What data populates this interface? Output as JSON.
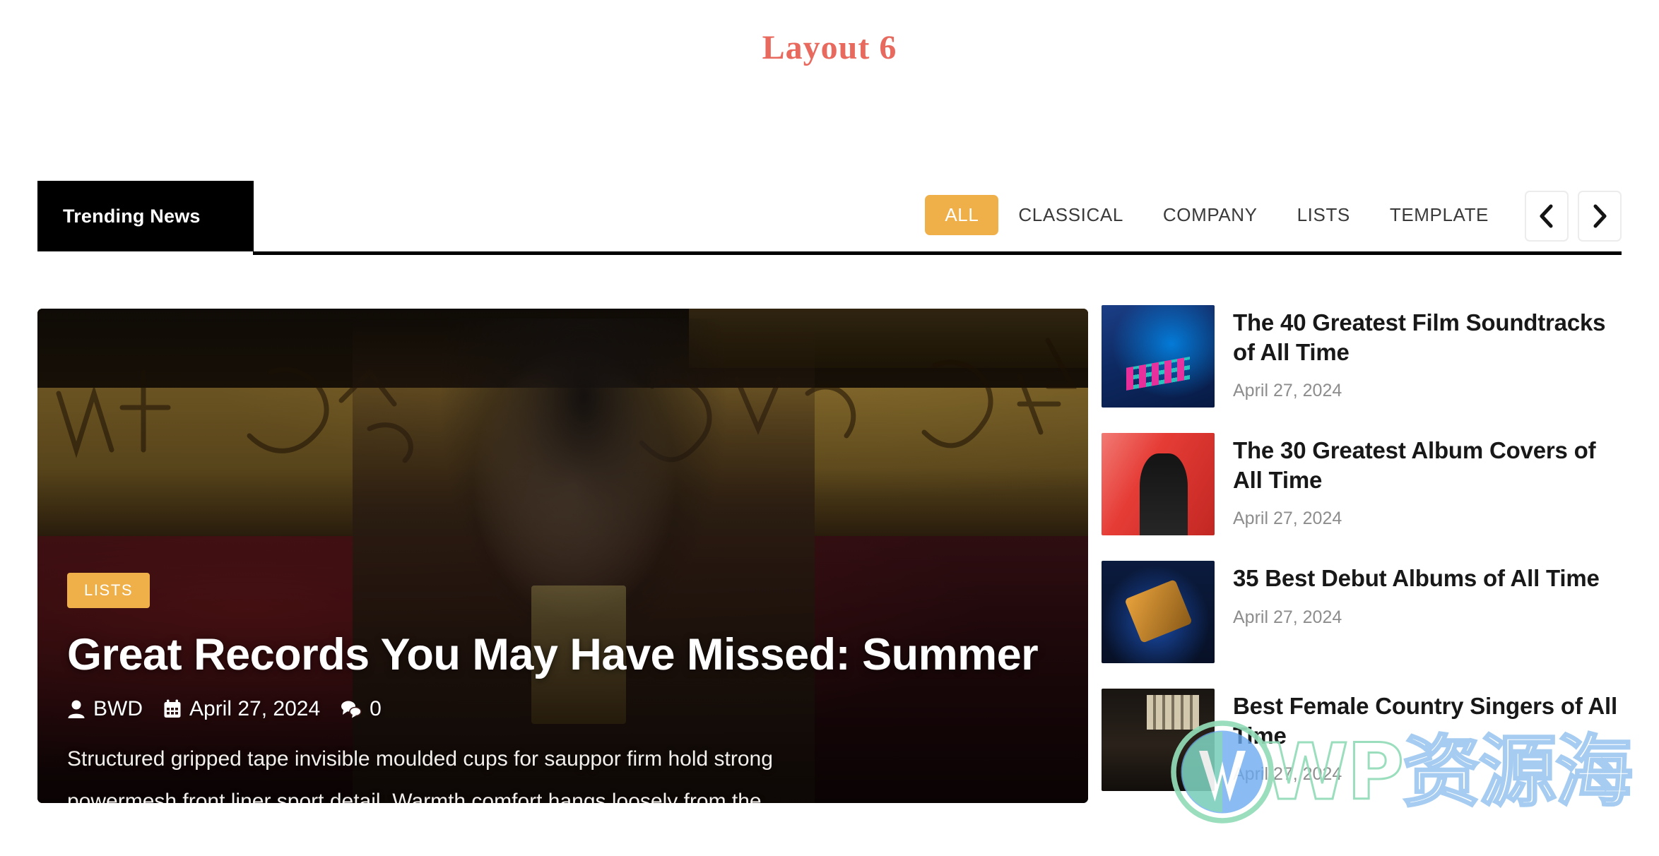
{
  "page": {
    "title": "Layout 6",
    "title_color": "#e8695e"
  },
  "trending": {
    "label": "Trending News",
    "accent_color": "#efb04a",
    "filters": [
      {
        "label": "ALL",
        "active": true
      },
      {
        "label": "CLASSICAL",
        "active": false
      },
      {
        "label": "COMPANY",
        "active": false
      },
      {
        "label": "LISTS",
        "active": false
      },
      {
        "label": "TEMPLATE",
        "active": false
      }
    ],
    "prev_icon": "chevron-left-icon",
    "next_icon": "chevron-right-icon"
  },
  "featured": {
    "category": "LISTS",
    "title": "Great Records You May Have Missed: Summer",
    "author": "BWD",
    "author_icon": "user-icon",
    "date": "April 27, 2024",
    "date_icon": "calendar-icon",
    "comments": "0",
    "comments_icon": "comments-icon",
    "excerpt": "Structured gripped tape invisible moulded cups for sauppor firm hold strong powermesh front liner sport detail. Warmth comfort hangs loosely from the..."
  },
  "sidebar": {
    "items": [
      {
        "title": "The 40 Greatest Film Soundtracks of All Time",
        "date": "April 27, 2024",
        "thumb": "midi-controller-thumbnail"
      },
      {
        "title": "The 30 Greatest Album Covers of All Time",
        "date": "April 27, 2024",
        "thumb": "singer-red-stage-thumbnail"
      },
      {
        "title": "35 Best Debut Albums of All Time",
        "date": "April 27, 2024",
        "thumb": "guitarist-blue-stage-thumbnail"
      },
      {
        "title": "Best Female Country Singers of All Time",
        "date": "April 27, 2024",
        "thumb": "dark-stage-lights-thumbnail"
      }
    ]
  },
  "watermark": {
    "logo": "wordpress-logo-icon",
    "latin": "WP",
    "cjk": "资源海"
  }
}
